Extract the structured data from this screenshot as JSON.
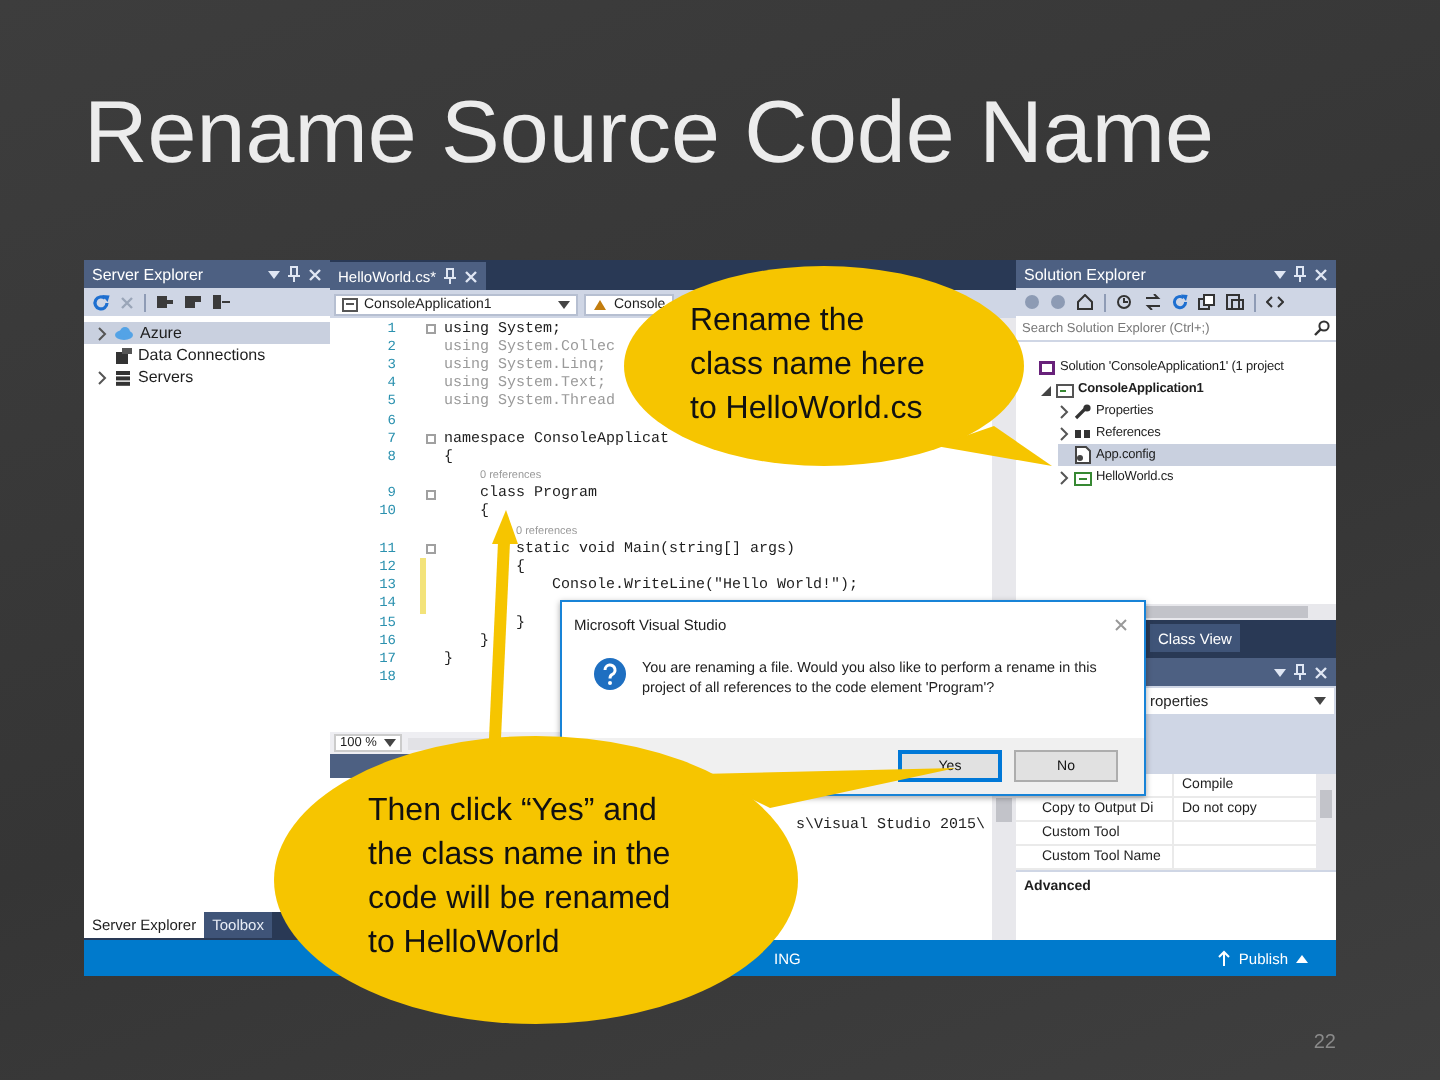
{
  "slide": {
    "title": "Rename Source Code Name",
    "page_number": "22"
  },
  "server_explorer": {
    "title": "Server Explorer",
    "items": [
      {
        "label": "Azure",
        "expanded": false,
        "selected": true
      },
      {
        "label": "Data Connections",
        "selected": false
      },
      {
        "label": "Servers",
        "expanded": false,
        "selected": false
      }
    ],
    "tabs": [
      {
        "label": "Server Explorer",
        "selected": true
      },
      {
        "label": "Toolbox",
        "selected": false
      }
    ]
  },
  "editor": {
    "tab": "HelloWorld.cs*",
    "nav": [
      "ConsoleApplication1",
      "Console"
    ],
    "lines": [
      {
        "kind": "code",
        "number": "1",
        "text": "using System;",
        "dimmed": false,
        "modified": false,
        "collapsible": true
      },
      {
        "kind": "code",
        "number": "2",
        "text": "using System.Collec",
        "dimmed": true,
        "modified": false,
        "collapsible": false
      },
      {
        "kind": "code",
        "number": "3",
        "text": "using System.Linq;",
        "dimmed": true,
        "modified": false,
        "collapsible": false
      },
      {
        "kind": "code",
        "number": "4",
        "text": "using System.Text;",
        "dimmed": true,
        "modified": false,
        "collapsible": false
      },
      {
        "kind": "code",
        "number": "5",
        "text": "using System.Thread",
        "dimmed": true,
        "modified": false,
        "collapsible": false
      },
      {
        "kind": "code",
        "number": "6",
        "modified": false,
        "collapsible": false
      },
      {
        "kind": "code",
        "number": "7",
        "text": "namespace ConsoleApplicat",
        "dimmed": false,
        "modified": false,
        "collapsible": true
      },
      {
        "kind": "code",
        "number": "8",
        "text": "{",
        "dimmed": false,
        "modified": false,
        "collapsible": false
      },
      {
        "kind": "lens",
        "text": "0 references"
      },
      {
        "kind": "code",
        "number": "9",
        "text": "    class Program",
        "dimmed": false,
        "modified": false,
        "collapsible": true
      },
      {
        "kind": "code",
        "number": "10",
        "text": "    {",
        "dimmed": false,
        "modified": false,
        "collapsible": false
      },
      {
        "kind": "lens",
        "text": "0 references"
      },
      {
        "kind": "code",
        "number": "11",
        "text": "        static void Main(string[] args)",
        "dimmed": false,
        "modified": false,
        "collapsible": true
      },
      {
        "kind": "code",
        "number": "12",
        "text": "        {",
        "dimmed": false,
        "modified": true,
        "collapsible": false
      },
      {
        "kind": "code",
        "number": "13",
        "text": "            Console.WriteLine(\"Hello World!\");",
        "dimmed": false,
        "modified": true,
        "collapsible": false
      },
      {
        "kind": "code",
        "number": "14",
        "modified": true,
        "collapsible": false
      },
      {
        "kind": "code",
        "number": "15",
        "text": "        }",
        "dimmed": false,
        "modified": false,
        "collapsible": false
      },
      {
        "kind": "code",
        "number": "16",
        "text": "    }",
        "dimmed": false,
        "modified": false,
        "collapsible": false
      },
      {
        "kind": "code",
        "number": "17",
        "text": "}",
        "dimmed": false,
        "modified": false,
        "collapsible": false
      },
      {
        "kind": "code",
        "number": "18",
        "modified": false,
        "collapsible": false
      }
    ],
    "zoom": "100 %"
  },
  "output": {
    "lines": [
      "s\\Visual Studio 2015\\"
    ]
  },
  "solution_explorer": {
    "title": "Solution Explorer",
    "search_placeholder": "Search Solution Explorer (Ctrl+;)",
    "tree": [
      {
        "label": "Solution 'ConsoleApplication1' (1 project",
        "kind": "solution",
        "selected": false,
        "children": [
          {
            "label": "ConsoleApplication1",
            "kind": "project",
            "expanded": true,
            "selected": false,
            "children": [
              {
                "label": "Properties",
                "kind": "properties",
                "expanded": false,
                "selected": false
              },
              {
                "label": "References",
                "kind": "references",
                "expanded": false,
                "selected": false
              },
              {
                "label": "App.config",
                "kind": "config",
                "selected": true
              },
              {
                "label": "HelloWorld.cs",
                "kind": "csharp",
                "expanded": false,
                "selected": false
              }
            ]
          }
        ]
      }
    ]
  },
  "lower_tab": "Class View",
  "properties": {
    "object": "roperties",
    "rows": [
      {
        "value": "Compile"
      },
      {
        "name": "Copy to Output Di",
        "value": "Do not copy"
      },
      {
        "name": "Custom Tool"
      },
      {
        "name": "Custom Tool Name"
      }
    ],
    "description": "Advanced"
  },
  "status_bar": {
    "text": "ING",
    "publish": "Publish"
  },
  "dialog": {
    "title": "Microsoft Visual Studio",
    "message": "You are renaming a file. Would you also like to perform a rename in this project of all references to the code element 'Program'?",
    "buttons": [
      {
        "label": "Yes",
        "selected": true
      },
      {
        "label": "No",
        "selected": false
      }
    ]
  },
  "callouts": [
    {
      "text": "Rename the class name here to HelloWorld.cs"
    },
    {
      "text": "Then click “Yes” and the class name in the code will be renamed to HelloWorld"
    }
  ]
}
